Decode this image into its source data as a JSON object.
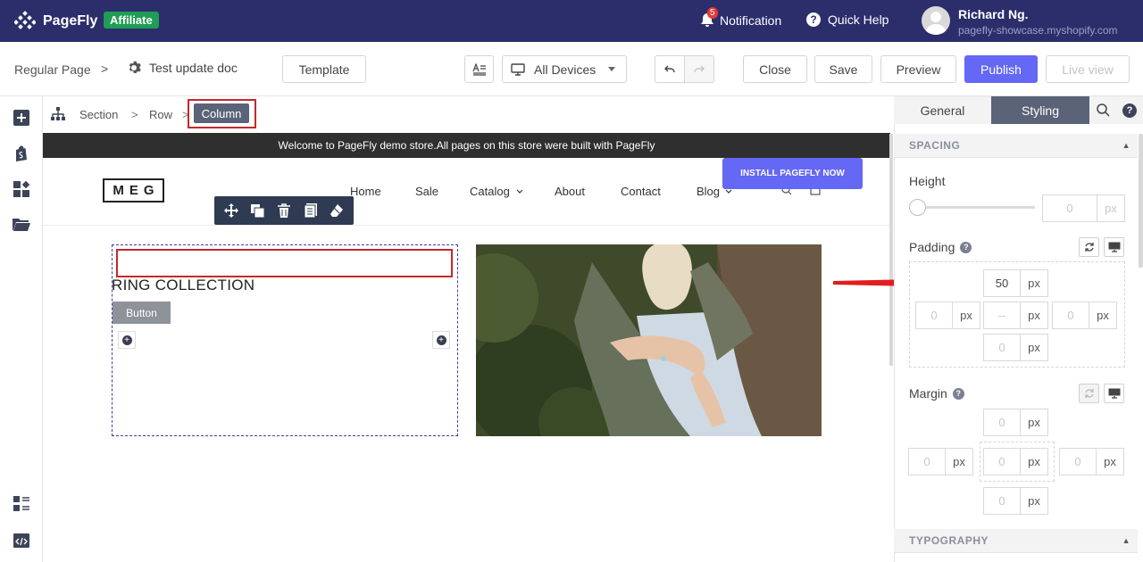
{
  "topbar": {
    "app_name": "PageFly",
    "badge": "Affiliate",
    "notification_count": "5",
    "notification_label": "Notification",
    "help_label": "Quick Help",
    "user_name": "Richard Ng.",
    "user_store": "pagefly-showcase.myshopify.com"
  },
  "toolbar": {
    "page_type": "Regular Page",
    "crumb_sep": ">",
    "doc_name": "Test update doc",
    "template_label": "Template",
    "device_label": "All Devices",
    "close_label": "Close",
    "save_label": "Save",
    "preview_label": "Preview",
    "publish_label": "Publish",
    "liveview_label": "Live view"
  },
  "canvas": {
    "crumbs": [
      "Section",
      "Row",
      "Column"
    ],
    "announcement": "Welcome to PageFly demo store.All pages on this store were built with PageFly",
    "logo": "MEG",
    "nav": [
      "Home",
      "Sale",
      "Catalog",
      "About",
      "Contact",
      "Blog"
    ],
    "install_button": "INSTALL PAGEFLY NOW",
    "heading": "RING COLLECTION",
    "button_label": "Button"
  },
  "panel": {
    "tabs": [
      "General",
      "Styling"
    ],
    "active_tab": "Styling",
    "spacing_header": "SPACING",
    "height_label": "Height",
    "height_value": "0",
    "unit": "px",
    "padding_label": "Padding",
    "padding": {
      "top": "50",
      "left": "0",
      "center": "--",
      "right": "0",
      "bottom": "0"
    },
    "margin_label": "Margin",
    "margin": {
      "top": "0",
      "left": "0",
      "center": "0",
      "right": "0",
      "bottom": "0"
    },
    "typography_header": "TYPOGRAPHY"
  },
  "colors": {
    "topbar_bg": "#2b2e6b",
    "publish": "#6567f5",
    "affiliate": "#1f9d55",
    "highlight": "#c62828"
  }
}
